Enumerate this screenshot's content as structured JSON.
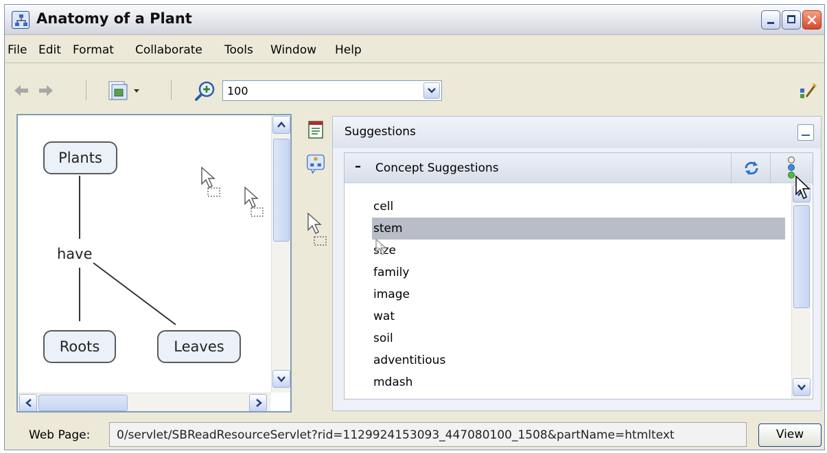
{
  "window": {
    "title": "Anatomy of a Plant"
  },
  "menu": [
    "File",
    "Edit",
    "Format",
    "Collaborate",
    "Tools",
    "Window",
    "Help"
  ],
  "toolbar": {
    "zoom_value": "100"
  },
  "map": {
    "concepts": {
      "plants": "Plants",
      "roots": "Roots",
      "leaves": "Leaves"
    },
    "linking_phrase": "have"
  },
  "suggestions": {
    "panel_title": "Suggestions",
    "concept_section_title": "Concept Suggestions",
    "words": [
      "cell",
      "stem",
      "size",
      "family",
      "image",
      "wat",
      "soil",
      "adventitious",
      "mdash",
      ""
    ],
    "selected": "stem"
  },
  "status": {
    "label": "Web Page:",
    "url": "0/servlet/SBReadResourceServlet?rid=1129924153093_447080100_1508&partName=htmltext",
    "view_label": "View"
  },
  "icons": [
    "app-icon",
    "back-arrow-icon",
    "forward-arrow-icon",
    "view-icon",
    "zoom-icon",
    "wand-icon",
    "notes-icon",
    "concept-suggestion-icon",
    "refresh-icon",
    "connection-icon",
    "drag-cursor-icon"
  ]
}
